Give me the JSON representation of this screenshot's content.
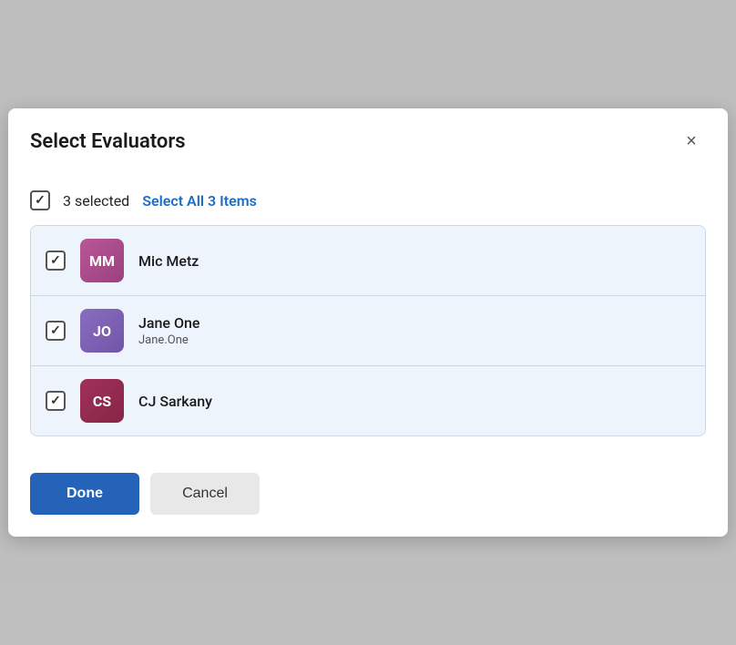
{
  "modal": {
    "title": "Select Evaluators",
    "close_label": "×"
  },
  "select_all": {
    "selected_count_text": "3 selected",
    "select_all_label": "Select All 3 Items"
  },
  "list": {
    "items": [
      {
        "id": "mm",
        "initials": "MM",
        "name": "Mic Metz",
        "subtitle": "",
        "avatar_class": "avatar-mm",
        "checked": true
      },
      {
        "id": "jo",
        "initials": "JO",
        "name": "Jane One",
        "subtitle": "Jane.One",
        "avatar_class": "avatar-jo",
        "checked": true
      },
      {
        "id": "cs",
        "initials": "CS",
        "name": "CJ Sarkany",
        "subtitle": "",
        "avatar_class": "avatar-cs",
        "checked": true
      }
    ]
  },
  "footer": {
    "done_label": "Done",
    "cancel_label": "Cancel"
  }
}
